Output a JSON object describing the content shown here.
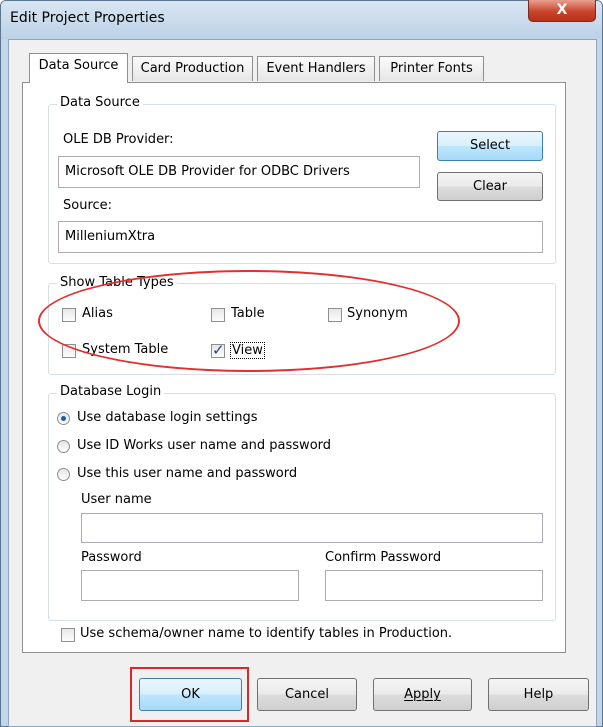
{
  "window": {
    "title": "Edit Project Properties",
    "close_glyph": "X"
  },
  "tabs": [
    {
      "label": "Data Source",
      "active": true
    },
    {
      "label": "Card Production",
      "active": false
    },
    {
      "label": "Event Handlers",
      "active": false
    },
    {
      "label": "Printer Fonts",
      "active": false
    }
  ],
  "data_source": {
    "group_label": "Data Source",
    "provider_label": "OLE DB Provider:",
    "provider_value": "Microsoft OLE DB Provider for ODBC Drivers",
    "source_label": "Source:",
    "source_value": "MilleniumXtra",
    "select_button": "Select",
    "clear_button": "Clear"
  },
  "table_types": {
    "group_label": "Show Table Types",
    "items": [
      {
        "label": "Alias",
        "checked": false
      },
      {
        "label": "Table",
        "checked": false
      },
      {
        "label": "Synonym",
        "checked": false
      },
      {
        "label": "System Table",
        "checked": false
      },
      {
        "label": "View",
        "checked": true
      }
    ]
  },
  "login": {
    "group_label": "Database Login",
    "options": [
      {
        "label": "Use database login settings",
        "selected": true
      },
      {
        "label": "Use ID Works user name and password",
        "selected": false
      },
      {
        "label": "Use this user name and password",
        "selected": false
      }
    ],
    "user_name_label": "User name",
    "user_name_value": "",
    "password_label": "Password",
    "password_value": "",
    "confirm_password_label": "Confirm Password",
    "confirm_password_value": ""
  },
  "schema_option": {
    "label": "Use schema/owner name to identify tables in Production.",
    "checked": false
  },
  "footer": {
    "ok": "OK",
    "cancel": "Cancel",
    "apply": "Apply",
    "help": "Help"
  },
  "annotations": {
    "ellipse_color": "#e03030",
    "rect_color": "#d42a2a"
  }
}
